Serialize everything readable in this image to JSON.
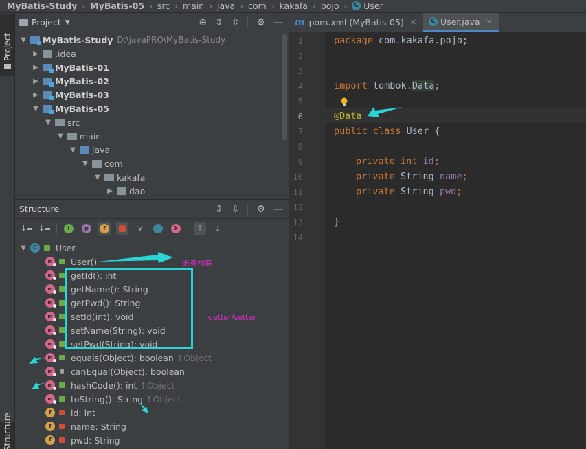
{
  "breadcrumb": {
    "items": [
      "MyBatis-Study",
      "MyBatis-05",
      "src",
      "main",
      "java",
      "com",
      "kakafa",
      "pojo",
      "User"
    ],
    "class_icon_letter": "C"
  },
  "side_tabs": {
    "project": "Project",
    "structure": "Structure"
  },
  "project_panel": {
    "title": "Project",
    "tree": [
      {
        "name": "MyBatis-Study",
        "path": "D:\\javaPRO\\MyBatis-Study"
      },
      {
        "name": ".idea"
      },
      {
        "name": "MyBatis-01"
      },
      {
        "name": "MyBatis-02"
      },
      {
        "name": "MyBatis-03"
      },
      {
        "name": "MyBatis-05"
      },
      {
        "name": "src"
      },
      {
        "name": "main"
      },
      {
        "name": "java"
      },
      {
        "name": "com"
      },
      {
        "name": "kakafa"
      },
      {
        "name": "dao"
      }
    ]
  },
  "structure_panel": {
    "title": "Structure",
    "root": {
      "icon": "C",
      "label": "User"
    },
    "members": [
      {
        "icon": "m",
        "label": "User()"
      },
      {
        "icon": "m",
        "label": "getId(): int"
      },
      {
        "icon": "m",
        "label": "getName(): String"
      },
      {
        "icon": "m",
        "label": "getPwd(): String"
      },
      {
        "icon": "m",
        "label": "setId(int): void"
      },
      {
        "icon": "m",
        "label": "setName(String): void"
      },
      {
        "icon": "m",
        "label": "setPwd(String): void"
      },
      {
        "icon": "m",
        "label": "equals(Object): boolean",
        "inherited": "↑Object"
      },
      {
        "icon": "m",
        "label": "canEqual(Object): boolean"
      },
      {
        "icon": "m",
        "label": "hashCode(): int",
        "inherited": "↑Object"
      },
      {
        "icon": "m",
        "label": "toString(): String",
        "inherited": "↑Object"
      },
      {
        "icon": "f",
        "label": "id: int"
      },
      {
        "icon": "f",
        "label": "name: String"
      },
      {
        "icon": "f",
        "label": "pwd: String"
      }
    ],
    "toolbar_letters": [
      "I",
      "p",
      "f",
      "λ"
    ]
  },
  "editor": {
    "tabs": [
      {
        "label": "pom.xml (MyBatis-05)",
        "icon": "m"
      },
      {
        "label": "User.java",
        "icon": "C"
      }
    ],
    "lines": {
      "l1_kw": "package",
      "l1_rest": " com.kakafa.pojo;",
      "l4_kw": "import",
      "l4_pkg": " lombok.",
      "l4_sym": "Data",
      "l4_end": ";",
      "l6_ann": "@Data",
      "l7_kw": "public class",
      "l7_rest": " User {",
      "l9_kw": "private",
      "l9_type": " int ",
      "l9_fld": "id",
      "l10_kw": "private",
      "l10_type": " String ",
      "l10_fld": "name",
      "l11_kw": "private",
      "l11_type": " String ",
      "l11_fld": "pwd",
      "semi": ";",
      "l13": "}"
    },
    "line_numbers": [
      "1",
      "2",
      "3",
      "4",
      "5",
      "6",
      "7",
      "8",
      "9",
      "10",
      "11",
      "12",
      "13",
      "14"
    ]
  },
  "annotations": {
    "no_arg": "无参构造",
    "getter_setter": "getter/setter",
    "color_box": "#2ad5d8",
    "color_text": "#e22dd5"
  }
}
